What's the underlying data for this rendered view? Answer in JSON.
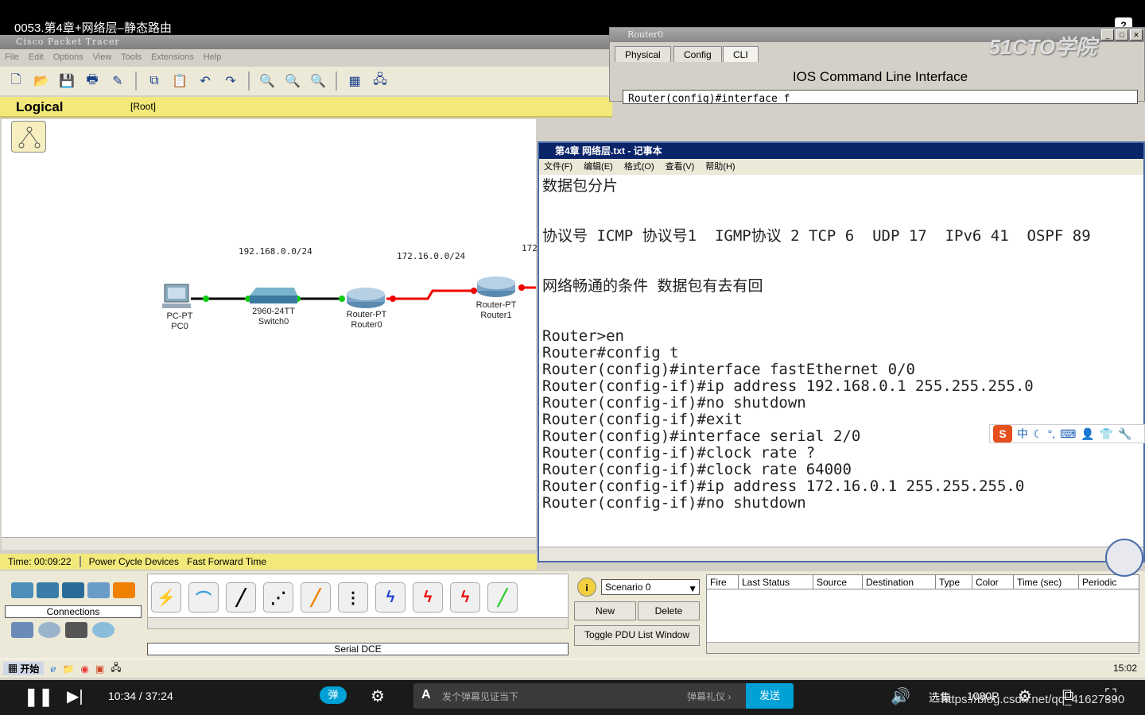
{
  "video": {
    "title": "0053.第4章+网络层–静态路由",
    "help": "?"
  },
  "pt": {
    "title": "Cisco Packet Tracer",
    "menu": [
      "File",
      "Edit",
      "Options",
      "View",
      "Tools",
      "Extensions",
      "Help"
    ],
    "logical": "Logical",
    "root": "[Root]",
    "status": {
      "time": "Time: 00:09:22",
      "power": "Power Cycle Devices",
      "fast": "Fast Forward Time"
    },
    "network": {
      "net1": "192.168.0.0/24",
      "net2": "172.16.0.0/24",
      "net3": "172",
      "pc": [
        "PC-PT",
        "PC0"
      ],
      "switch": [
        "2960-24TT",
        "Switch0"
      ],
      "router0": [
        "Router-PT",
        "Router0"
      ],
      "router1": [
        "Router-PT",
        "Router1"
      ]
    },
    "connections_label": "Connections",
    "cable_name": "Serial DCE",
    "scenario": "Scenario 0",
    "new_btn": "New",
    "delete_btn": "Delete",
    "toggle_btn": "Toggle PDU List Window",
    "pdu_columns": [
      "Fire",
      "Last Status",
      "Source",
      "Destination",
      "Type",
      "Color",
      "Time (sec)",
      "Periodic"
    ],
    "clock": "15:02",
    "start": "开始"
  },
  "router_window": {
    "title": "Router0",
    "watermark": "51CTO学院",
    "tabs": [
      "Physical",
      "Config",
      "CLI"
    ],
    "ios_title": "IOS Command Line Interface",
    "cli_line": "Router(config)#interface f"
  },
  "notepad": {
    "title": "第4章 网络层.txt - 记事本",
    "menu": [
      "文件(F)",
      "编辑(E)",
      "格式(O)",
      "查看(V)",
      "帮助(H)"
    ],
    "lines": [
      "数据包分片",
      "",
      "",
      "协议号 ICMP 协议号1  IGMP协议 2 TCP 6  UDP 17  IPv6 41  OSPF 89",
      "",
      "",
      "网络畅通的条件 数据包有去有回",
      "",
      "",
      "Router>en",
      "Router#config t",
      "Router(config)#interface fastEthernet 0/0",
      "Router(config-if)#ip address 192.168.0.1 255.255.255.0",
      "Router(config-if)#no shutdown",
      "Router(config-if)#exit",
      "Router(config)#interface serial 2/0",
      "Router(config-if)#clock rate ?",
      "Router(config-if)#clock rate 64000",
      "Router(config-if)#ip address 172.16.0.1 255.255.255.0",
      "Router(config-if)#no shutdown"
    ]
  },
  "ime": {
    "text": "中"
  },
  "player": {
    "time": "10:34 / 37:24",
    "danmaku_btn": "弹",
    "danmaku_placeholder": "发个弹幕见证当下",
    "etiquette": "弹幕礼仪 ›",
    "send": "发送",
    "select": "选集",
    "quality": "1080P",
    "url": "https://blog.csdn.net/qq_41627390"
  }
}
